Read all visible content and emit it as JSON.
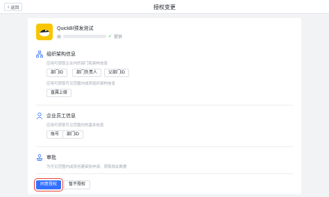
{
  "header": {
    "back_label": "返回",
    "title": "授权变更"
  },
  "app": {
    "name": "QuickBI预发测试",
    "by_prefix": "由",
    "provider_suffix": "提供"
  },
  "sections": [
    {
      "title": "组织架构信息",
      "desc": "应用可获取企业内的部门和架构信息",
      "tags": [
        "部门ID",
        "部门负责人",
        "父部门ID"
      ],
      "desc2": "应用可获取可见范围内成员组织架构信息",
      "tags2": [
        "直属上级"
      ]
    },
    {
      "title": "企业员工信息",
      "desc": "应用可获取可见范围内的基本信息",
      "tags": [
        "账号",
        "部门ID"
      ]
    },
    {
      "title": "审批",
      "desc": "为可见范围内成员创建审批申请、获取相关数据"
    }
  ],
  "actions": {
    "agree_label": "同意授权",
    "decline_label": "暂不授权"
  },
  "colors": {
    "primary": "#3370ff",
    "logo": "#f7c600",
    "highlight": "#e53935"
  }
}
